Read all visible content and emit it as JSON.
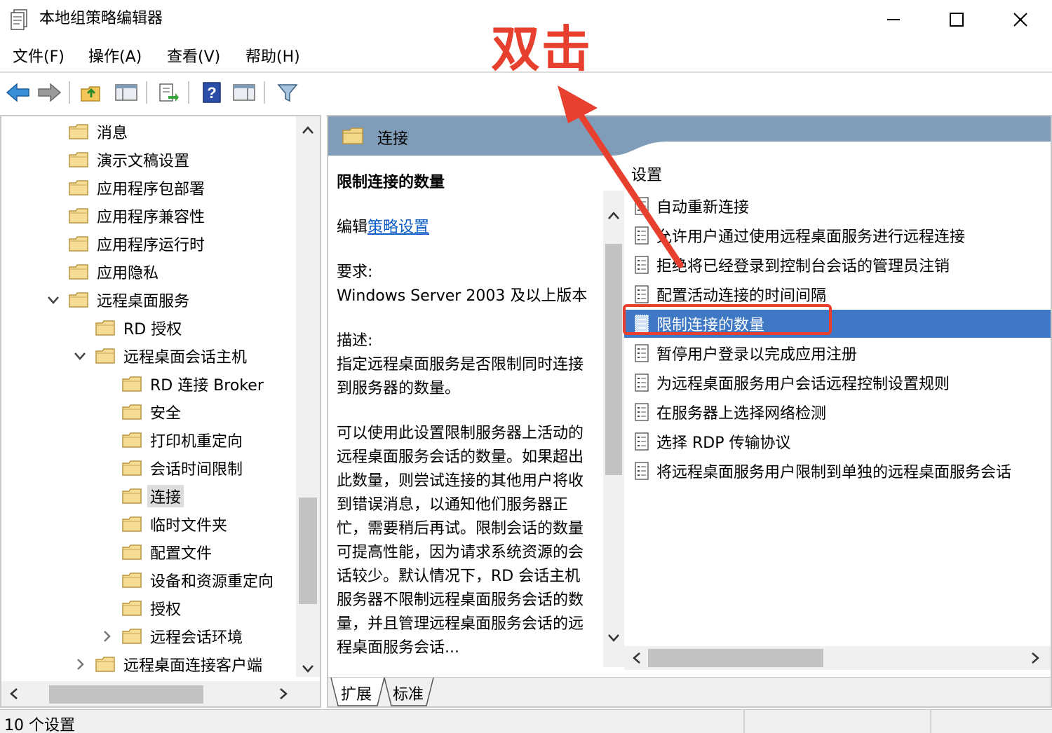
{
  "window": {
    "title": "本地组策略编辑器"
  },
  "menu": {
    "items": [
      "文件(F)",
      "操作(A)",
      "查看(V)",
      "帮助(H)"
    ]
  },
  "tree": {
    "items": [
      {
        "label": "消息"
      },
      {
        "label": "演示文稿设置"
      },
      {
        "label": "应用程序包部署"
      },
      {
        "label": "应用程序兼容性"
      },
      {
        "label": "应用程序运行时"
      },
      {
        "label": "应用隐私"
      },
      {
        "label": "远程桌面服务"
      },
      {
        "label": "RD 授权"
      },
      {
        "label": "远程桌面会话主机"
      },
      {
        "label": "RD 连接 Broker"
      },
      {
        "label": "安全"
      },
      {
        "label": "打印机重定向"
      },
      {
        "label": "会话时间限制"
      },
      {
        "label": "连接"
      },
      {
        "label": "临时文件夹"
      },
      {
        "label": "配置文件"
      },
      {
        "label": "设备和资源重定向"
      },
      {
        "label": "授权"
      },
      {
        "label": "远程会话环境"
      },
      {
        "label": "远程桌面连接客户端"
      }
    ]
  },
  "header": {
    "title": "连接"
  },
  "description": {
    "title": "限制连接的数量",
    "edit_prefix": "编辑",
    "edit_link": "策略设置",
    "requirements_label": "要求:",
    "requirements_text": "Windows Server 2003 及以上版本",
    "description_label": "描述:",
    "description_text": "指定远程桌面服务是否限制同时连接到服务器的数量。",
    "body_text": "可以使用此设置限制服务器上活动的远程桌面服务会话的数量。如果超出此数量，则尝试连接的其他用户将收到错误消息，以通知他们服务器正忙，需要稍后再试。限制会话的数量可提高性能，因为请求系统资源的会话较少。默认情况下，RD 会话主机服务器不限制远程桌面服务会话的数量，并且管理远程桌面服务会话的远程桌面服务会话..."
  },
  "settings": {
    "column_header": "设置",
    "items": [
      {
        "label": "自动重新连接"
      },
      {
        "label": "允许用户通过使用远程桌面服务进行远程连接"
      },
      {
        "label": "拒绝将已经登录到控制台会话的管理员注销"
      },
      {
        "label": "配置活动连接的时间间隔"
      },
      {
        "label": "限制连接的数量"
      },
      {
        "label": "暂停用户登录以完成应用注册"
      },
      {
        "label": "为远程桌面服务用户会话远程控制设置规则"
      },
      {
        "label": "在服务器上选择网络检测"
      },
      {
        "label": "选择 RDP 传输协议"
      },
      {
        "label": "将远程桌面服务用户限制到单独的远程桌面服务会话"
      }
    ],
    "selected_index": 4
  },
  "tabs": {
    "items": [
      "扩展",
      "标准"
    ]
  },
  "status": {
    "text": "10 个设置"
  },
  "annotation": {
    "text": "双击",
    "color": "#e8402f"
  },
  "colors": {
    "selection": "#3f78c4",
    "header_band": "#7f9db9",
    "link": "#0b5cc5"
  }
}
